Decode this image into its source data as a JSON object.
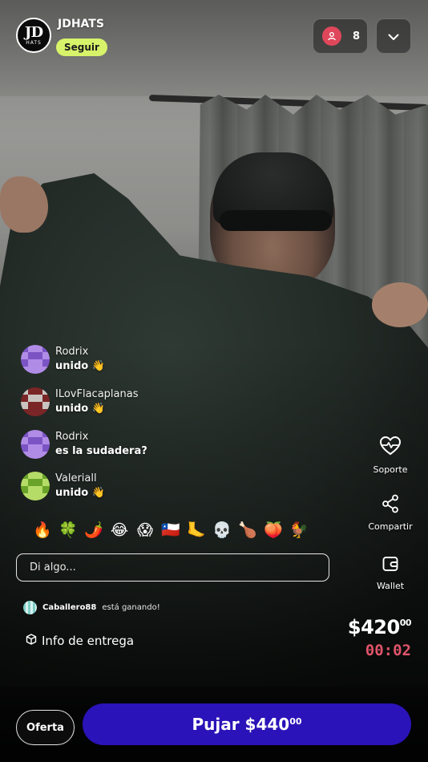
{
  "header": {
    "logo_text": "JD",
    "logo_subtext": "HATS",
    "shop_name": "JDHATS",
    "follow_label": "Seguir",
    "viewer_count": "8"
  },
  "chat": [
    {
      "user": "Rodrix",
      "message": "unido 👋",
      "avatar_colors": [
        "#7b54c4",
        "#b08ce6"
      ]
    },
    {
      "user": "ILovFlacaplanas",
      "message": "unido 👋",
      "avatar_colors": [
        "#c9c4c0",
        "#7a2626"
      ]
    },
    {
      "user": "Rodrix",
      "message": "es la sudadera?",
      "avatar_colors": [
        "#7b54c4",
        "#b08ce6"
      ]
    },
    {
      "user": "Valeriall",
      "message": "unido 👋",
      "avatar_colors": [
        "#6aa32a",
        "#b6dc68"
      ]
    }
  ],
  "reactions": [
    "🔥",
    "🍀",
    "🌶️",
    "😂",
    "😱",
    "🇨🇱",
    "🦶",
    "💀",
    "🍗",
    "🍑",
    "🐓"
  ],
  "tools": {
    "support_label": "Soporte",
    "share_label": "Compartir",
    "wallet_label": "Wallet"
  },
  "input": {
    "placeholder": "Di algo..."
  },
  "winning": {
    "user": "Caballero88",
    "text": "está ganando!"
  },
  "delivery_label": "Info de entrega",
  "auction": {
    "price_main": "$420",
    "price_cents": "00",
    "timer": "00:02"
  },
  "actions": {
    "offer_label": "Oferta",
    "bid_main": "Pujar $440",
    "bid_cents": "00"
  },
  "colors": {
    "follow_bg": "#d7f36a",
    "bid_bg": "#2a13b8",
    "timer": "#e0546a",
    "viewer_icon": "#e0475a"
  }
}
